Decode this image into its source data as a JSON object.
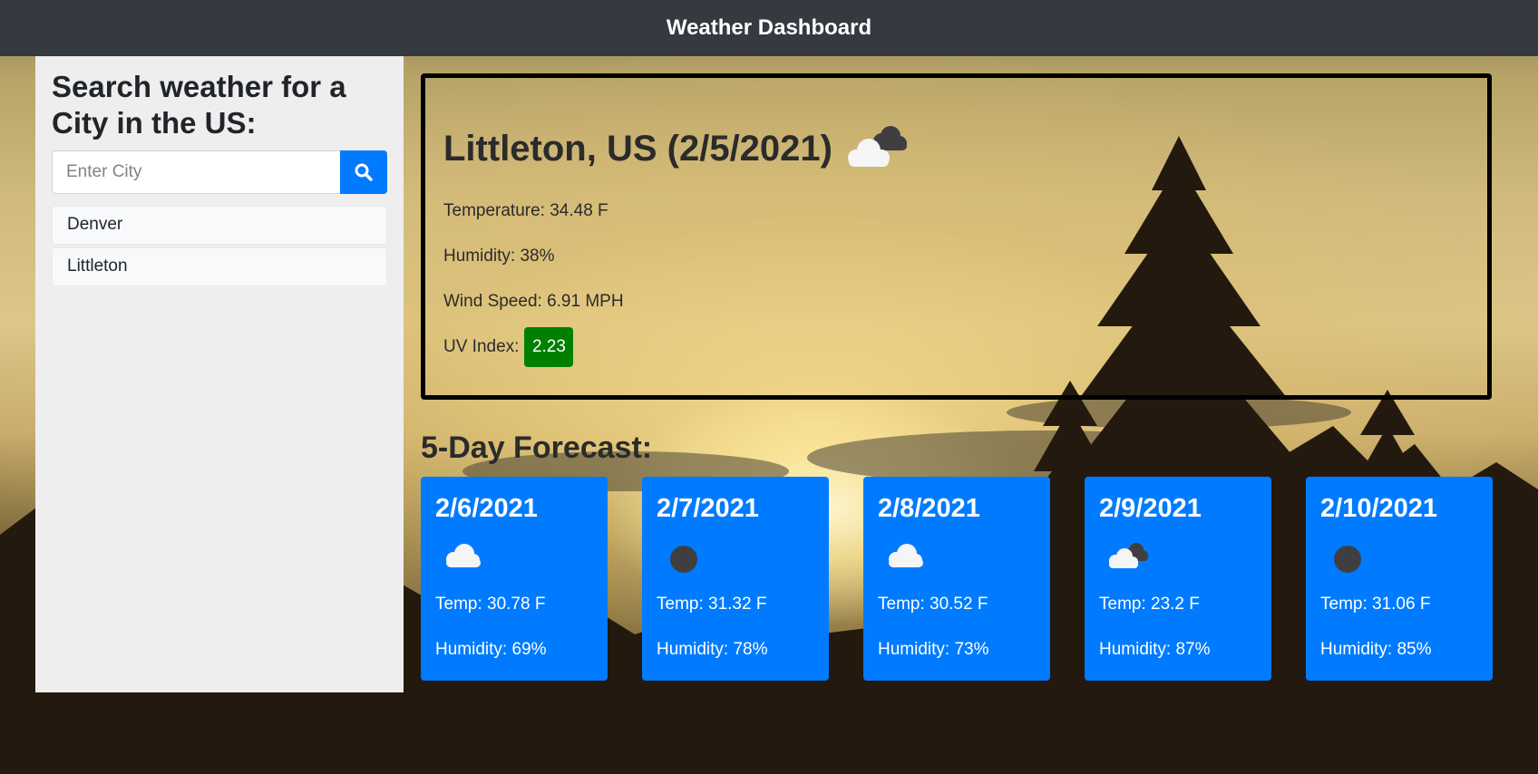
{
  "app": {
    "title": "Weather Dashboard"
  },
  "sidebar": {
    "heading": "Search weather for a City in the US:",
    "search": {
      "placeholder": "Enter City",
      "value": ""
    },
    "history": [
      {
        "label": "Denver"
      },
      {
        "label": "Littleton"
      }
    ]
  },
  "current": {
    "title": "Littleton, US (2/5/2021)",
    "icon": "clouds-icon",
    "temperature": "Temperature: 34.48 F",
    "humidity": "Humidity: 38%",
    "wind": "Wind Speed: 6.91 MPH",
    "uv_label": "UV Index:",
    "uv_value": "2.23",
    "uv_color": "#008000"
  },
  "forecast": {
    "heading": "5-Day Forecast:",
    "days": [
      {
        "date": "2/6/2021",
        "icon": "cloud-icon",
        "temp": "Temp: 30.78 F",
        "humidity": "Humidity: 69%"
      },
      {
        "date": "2/7/2021",
        "icon": "clear-night-icon",
        "temp": "Temp: 31.32 F",
        "humidity": "Humidity: 78%"
      },
      {
        "date": "2/8/2021",
        "icon": "cloud-icon",
        "temp": "Temp: 30.52 F",
        "humidity": "Humidity: 73%"
      },
      {
        "date": "2/9/2021",
        "icon": "clouds-icon",
        "temp": "Temp: 23.2 F",
        "humidity": "Humidity: 87%"
      },
      {
        "date": "2/10/2021",
        "icon": "clear-night-icon",
        "temp": "Temp: 31.06 F",
        "humidity": "Humidity: 85%"
      }
    ]
  },
  "colors": {
    "navbar": "#343a40",
    "accent": "#007bff",
    "sidebar": "#eeeeee"
  }
}
